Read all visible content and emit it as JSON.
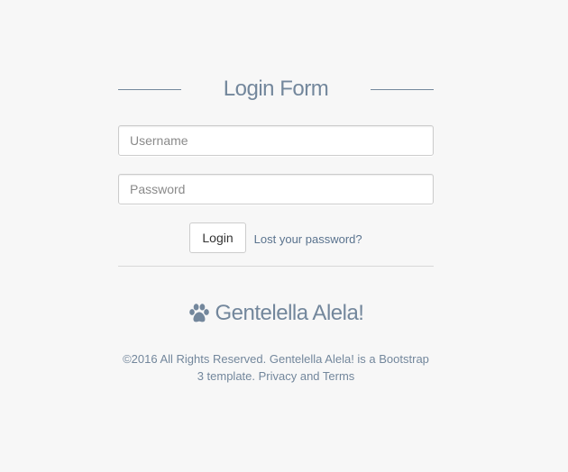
{
  "form": {
    "title": "Login Form",
    "username_placeholder": "Username",
    "password_placeholder": "Password",
    "login_label": "Login",
    "lost_password_label": "Lost your password?"
  },
  "brand": {
    "icon": "paw-icon",
    "name": "Gentelella Alela!"
  },
  "footer": {
    "text": "©2016 All Rights Reserved. Gentelella Alela! is a Bootstrap 3 template. Privacy and Terms"
  },
  "colors": {
    "background": "#f7f7f7",
    "heading": "#73879c",
    "link": "#5a738e",
    "border": "#cccccc"
  }
}
